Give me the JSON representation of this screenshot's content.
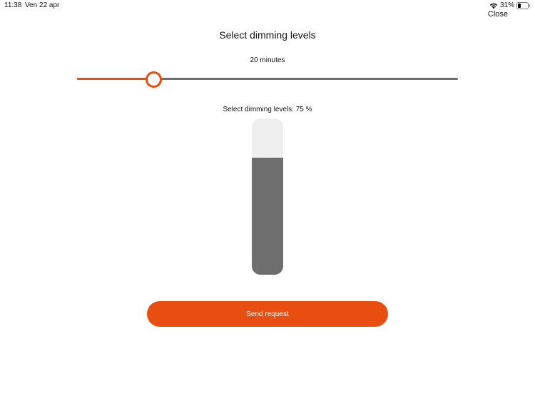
{
  "status_bar": {
    "time": "11:38",
    "date": "Ven 22 apr",
    "battery_percent": "31%",
    "battery_level": 0.31,
    "icons": [
      "wifi-icon",
      "battery-icon"
    ]
  },
  "header": {
    "close_label": "Close",
    "title": "Select dimming levels"
  },
  "duration": {
    "label": "20 minutes",
    "slider_fraction": 0.2
  },
  "dimming": {
    "label": "Select dimming levels: 75 %",
    "level_fraction": 0.75
  },
  "actions": {
    "send_label": "Send request"
  },
  "colors": {
    "accent": "#e84e0f",
    "track": "#6e6e6e",
    "track_empty": "#efefef"
  }
}
